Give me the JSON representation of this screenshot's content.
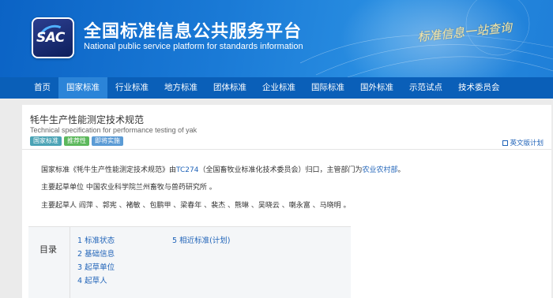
{
  "header": {
    "logo_text": "SAC",
    "title_cn": "全国标准信息公共服务平台",
    "title_en": "National public service platform  for standards information",
    "slogan": "标准信息一站查询"
  },
  "nav": {
    "items": [
      "首页",
      "国家标准",
      "行业标准",
      "地方标准",
      "团体标准",
      "企业标准",
      "国际标准",
      "国外标准",
      "示范试点",
      "技术委员会"
    ],
    "active_index": 1
  },
  "doc": {
    "title": "牦牛生产性能测定技术规范",
    "subtitle": "Technical specification for performance testing of yak",
    "tags": [
      "国家标准",
      "推荐性",
      "即将实施"
    ],
    "plan_link": "英文版计划",
    "intro_prefix": "国家标准《牦牛生产性能测定技术规范》由",
    "tc_link": "TC274",
    "intro_mid": "（全国畜牧业标准化技术委员会）归口，主管部门为",
    "dept_link": "农业农村部",
    "intro_suffix": "。",
    "org_line": "主要起草单位 中国农业科学院兰州畜牧与兽药研究所 。",
    "people_line": "主要起草人 阎萍 、郭宪 、褚敏 、包鹏甲 、梁春年 、裴杰 、熊琳 、吴晓云 、喇永富 、马晓明 。"
  },
  "toc": {
    "label": "目录",
    "items": [
      "1  标准状态",
      "2  基础信息",
      "3  起草单位",
      "4  起草人",
      "5  相近标准(计划)"
    ]
  }
}
